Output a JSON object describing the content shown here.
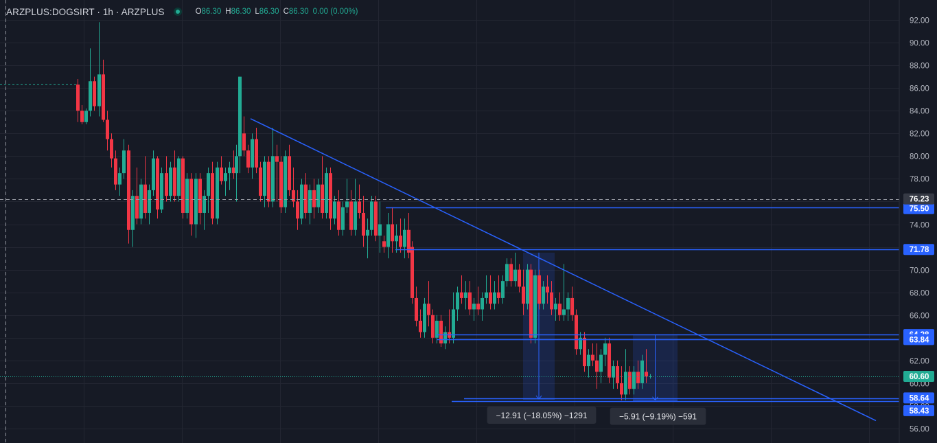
{
  "legend": {
    "symbol": "ARZPLUS:DOGSIRT · 1h · ARZPLUS",
    "o_key": "O",
    "o_val": "86.30",
    "h_key": "H",
    "h_val": "86.30",
    "l_key": "L",
    "l_val": "86.30",
    "c_key": "C",
    "c_val": "86.30",
    "change": "0.00 (0.00%)"
  },
  "colors": {
    "background": "#161a25",
    "up": "#22ab94",
    "down": "#f23645",
    "drawing": "#2962ff",
    "grid": "#232632"
  },
  "chart_data": {
    "type": "candlestick",
    "ylim": [
      55,
      93
    ],
    "y_ticks": [
      56,
      58,
      60,
      62,
      64,
      66,
      68,
      70,
      72,
      74,
      76,
      78,
      80,
      82,
      84,
      86,
      88,
      90,
      92
    ],
    "y_tick_labels": [
      "56.00",
      "58.00",
      "60.00",
      "62.00",
      "64.00",
      "66.00",
      "68.00",
      "70.00",
      "72.00",
      "74.00",
      "76.00",
      "78.00",
      "80.00",
      "82.00",
      "84.00",
      "86.00",
      "88.00",
      "90.00",
      "92.00"
    ],
    "x_range": [
      0,
      1310
    ],
    "candles": [
      [
        113,
        86.3,
        86.8,
        83.0,
        84.0
      ],
      [
        119,
        84.0,
        84.5,
        82.8,
        83.0
      ],
      [
        125,
        83.0,
        84.2,
        82.8,
        84.0
      ],
      [
        131,
        84.0,
        89.5,
        83.5,
        86.6
      ],
      [
        137,
        86.6,
        87.0,
        84.0,
        84.4
      ],
      [
        144,
        84.4,
        91.8,
        83.5,
        87.2
      ],
      [
        150,
        87.2,
        88.5,
        83.0,
        83.2
      ],
      [
        156,
        83.2,
        84.0,
        80.5,
        81.5
      ],
      [
        162,
        81.5,
        82.0,
        79.0,
        79.8
      ],
      [
        168,
        79.8,
        80.5,
        77.0,
        77.5
      ],
      [
        174,
        77.5,
        79.0,
        76.5,
        78.5
      ],
      [
        180,
        78.5,
        81.5,
        78.0,
        80.5
      ],
      [
        187,
        80.5,
        81.0,
        72.3,
        73.5
      ],
      [
        193,
        73.5,
        77.0,
        72.0,
        76.5
      ],
      [
        199,
        76.5,
        79.0,
        74.0,
        74.5
      ],
      [
        205,
        74.5,
        78.0,
        74.0,
        77.5
      ],
      [
        211,
        77.5,
        80.0,
        74.5,
        75.0
      ],
      [
        217,
        75.0,
        77.5,
        74.0,
        77.0
      ],
      [
        223,
        77.0,
        80.5,
        76.5,
        79.8
      ],
      [
        229,
        79.8,
        80.0,
        74.5,
        75.3
      ],
      [
        235,
        75.3,
        79.0,
        75.0,
        78.5
      ],
      [
        242,
        78.5,
        80.0,
        76.0,
        76.5
      ],
      [
        248,
        76.5,
        79.5,
        76.0,
        79.0
      ],
      [
        254,
        79.0,
        80.5,
        76.0,
        76.5
      ],
      [
        260,
        76.5,
        80.0,
        76.0,
        79.8
      ],
      [
        266,
        79.8,
        80.0,
        74.5,
        75.0
      ],
      [
        272,
        75.0,
        78.5,
        74.5,
        78.0
      ],
      [
        278,
        78.0,
        78.5,
        73.0,
        74.0
      ],
      [
        285,
        74.0,
        78.5,
        72.8,
        78.0
      ],
      [
        291,
        78.0,
        78.5,
        74.0,
        75.0
      ],
      [
        297,
        75.0,
        77.0,
        73.5,
        76.5
      ],
      [
        303,
        76.5,
        79.0,
        75.0,
        78.5
      ],
      [
        309,
        78.5,
        79.5,
        74.0,
        74.5
      ],
      [
        316,
        74.5,
        79.5,
        74.0,
        79.0
      ],
      [
        322,
        79.0,
        80.0,
        77.5,
        77.8
      ],
      [
        328,
        77.8,
        79.0,
        76.5,
        78.5
      ],
      [
        334,
        78.5,
        79.5,
        77.0,
        79.0
      ],
      [
        340,
        79.0,
        80.5,
        78.0,
        78.5
      ],
      [
        344,
        78.5,
        81.0,
        76.0,
        80.0
      ],
      [
        349,
        80.0,
        87.0,
        78.5,
        87.0
      ],
      [
        355,
        82.0,
        83.5,
        80.0,
        80.5
      ],
      [
        361,
        80.5,
        81.0,
        78.5,
        79.0
      ],
      [
        367,
        79.0,
        82.0,
        78.0,
        81.5
      ],
      [
        373,
        81.5,
        82.5,
        78.5,
        79.0
      ],
      [
        379,
        79.0,
        79.5,
        76.0,
        76.5
      ],
      [
        385,
        76.5,
        80.0,
        75.5,
        79.5
      ],
      [
        391,
        79.5,
        80.0,
        75.5,
        76.0
      ],
      [
        397,
        76.0,
        82.5,
        75.5,
        80.0
      ],
      [
        403,
        80.0,
        81.0,
        76.0,
        79.5
      ],
      [
        409,
        79.5,
        80.0,
        75.0,
        75.5
      ],
      [
        415,
        75.5,
        80.5,
        75.0,
        80.0
      ],
      [
        421,
        80.0,
        81.0,
        76.5,
        77.0
      ],
      [
        427,
        77.0,
        79.0,
        75.5,
        76.0
      ],
      [
        433,
        76.0,
        77.0,
        73.5,
        74.5
      ],
      [
        439,
        74.5,
        78.0,
        74.0,
        77.5
      ],
      [
        445,
        77.5,
        78.5,
        74.5,
        75.0
      ],
      [
        451,
        75.0,
        77.5,
        74.0,
        77.0
      ],
      [
        457,
        77.0,
        78.0,
        74.5,
        75.5
      ],
      [
        463,
        75.5,
        78.0,
        75.0,
        77.5
      ],
      [
        469,
        77.5,
        80.0,
        74.5,
        75.0
      ],
      [
        475,
        75.0,
        79.0,
        74.5,
        78.5
      ],
      [
        481,
        78.5,
        79.0,
        73.5,
        74.5
      ],
      [
        487,
        74.5,
        76.5,
        74.0,
        76.0
      ],
      [
        493,
        76.0,
        77.0,
        73.0,
        73.5
      ],
      [
        499,
        73.5,
        76.0,
        73.0,
        75.5
      ],
      [
        505,
        75.5,
        78.0,
        75.0,
        76.0
      ],
      [
        511,
        76.0,
        77.0,
        73.0,
        73.5
      ],
      [
        517,
        73.5,
        78.0,
        73.0,
        76.0
      ],
      [
        523,
        76.0,
        77.5,
        74.5,
        75.0
      ],
      [
        529,
        75.0,
        76.5,
        72.0,
        73.0
      ],
      [
        535,
        73.0,
        74.5,
        71.0,
        73.5
      ],
      [
        541,
        73.5,
        76.5,
        73.0,
        76.0
      ],
      [
        547,
        76.0,
        76.5,
        72.5,
        73.0
      ],
      [
        553,
        73.0,
        76.0,
        71.5,
        74.0
      ],
      [
        559,
        72.5,
        73.0,
        71.5,
        72.0
      ],
      [
        565,
        72.0,
        75.0,
        71.0,
        74.0
      ],
      [
        571,
        74.0,
        75.5,
        71.5,
        72.5
      ],
      [
        577,
        72.5,
        74.0,
        71.5,
        73.0
      ],
      [
        583,
        73.0,
        74.5,
        71.5,
        72.0
      ],
      [
        589,
        72.0,
        74.5,
        71.0,
        73.5
      ],
      [
        595,
        73.5,
        75.0,
        71.0,
        71.5
      ],
      [
        600,
        72.0,
        72.5,
        67.0,
        67.5
      ],
      [
        606,
        67.5,
        68.5,
        65.0,
        65.5
      ],
      [
        612,
        65.5,
        66.5,
        64.0,
        64.5
      ],
      [
        618,
        64.5,
        67.5,
        64.0,
        67.0
      ],
      [
        624,
        67.0,
        69.0,
        65.0,
        66.0
      ],
      [
        630,
        66.0,
        66.5,
        63.5,
        64.0
      ],
      [
        636,
        64.0,
        66.0,
        63.5,
        65.5
      ],
      [
        642,
        65.5,
        66.0,
        63.2,
        63.5
      ],
      [
        648,
        63.5,
        65.0,
        63.0,
        64.5
      ],
      [
        654,
        64.5,
        66.5,
        63.5,
        64.0
      ],
      [
        660,
        64.0,
        68.0,
        63.5,
        66.5
      ],
      [
        666,
        66.5,
        68.5,
        65.5,
        68.0
      ],
      [
        672,
        68.0,
        69.5,
        67.0,
        67.5
      ],
      [
        678,
        67.5,
        69.0,
        66.5,
        68.0
      ],
      [
        684,
        68.0,
        69.0,
        66.0,
        66.5
      ],
      [
        690,
        66.5,
        67.5,
        65.5,
        67.0
      ],
      [
        696,
        67.0,
        68.5,
        66.0,
        66.5
      ],
      [
        702,
        66.5,
        68.0,
        65.5,
        67.5
      ],
      [
        708,
        67.5,
        69.5,
        67.0,
        68.0
      ],
      [
        714,
        68.0,
        69.5,
        66.5,
        67.0
      ],
      [
        720,
        67.0,
        69.0,
        66.5,
        68.0
      ],
      [
        726,
        68.0,
        69.5,
        67.0,
        67.5
      ],
      [
        732,
        67.5,
        69.5,
        67.0,
        69.0
      ],
      [
        738,
        69.0,
        71.0,
        68.5,
        70.5
      ],
      [
        744,
        70.5,
        71.0,
        68.5,
        69.0
      ],
      [
        750,
        69.0,
        71.5,
        68.5,
        70.0
      ],
      [
        756,
        70.0,
        70.5,
        68.0,
        68.5
      ],
      [
        762,
        68.5,
        70.0,
        66.0,
        67.0
      ],
      [
        768,
        67.0,
        70.5,
        66.5,
        70.0
      ],
      [
        773,
        70.0,
        70.5,
        63.5,
        64.0
      ],
      [
        779,
        64.0,
        70.0,
        63.5,
        69.5
      ],
      [
        785,
        69.5,
        70.0,
        66.5,
        67.0
      ],
      [
        791,
        67.0,
        69.0,
        66.5,
        68.5
      ],
      [
        797,
        68.5,
        69.5,
        67.0,
        68.0
      ],
      [
        803,
        68.0,
        69.0,
        66.0,
        66.5
      ],
      [
        809,
        66.5,
        67.5,
        65.5,
        67.0
      ],
      [
        815,
        67.0,
        68.0,
        65.5,
        66.0
      ],
      [
        821,
        66.0,
        70.5,
        65.5,
        66.5
      ],
      [
        827,
        66.5,
        68.0,
        65.5,
        67.5
      ],
      [
        833,
        67.5,
        68.5,
        65.5,
        66.0
      ],
      [
        839,
        66.0,
        66.5,
        62.5,
        63.0
      ],
      [
        845,
        63.0,
        64.5,
        62.5,
        64.0
      ],
      [
        851,
        64.0,
        64.5,
        61.0,
        61.5
      ],
      [
        857,
        61.5,
        63.0,
        60.5,
        62.5
      ],
      [
        863,
        62.5,
        63.5,
        61.5,
        62.0
      ],
      [
        869,
        62.0,
        63.5,
        59.5,
        61.0
      ],
      [
        875,
        61.0,
        63.0,
        60.0,
        62.5
      ],
      [
        881,
        62.5,
        64.0,
        61.5,
        63.5
      ],
      [
        887,
        63.5,
        64.0,
        60.0,
        60.5
      ],
      [
        893,
        60.5,
        62.0,
        59.5,
        61.5
      ],
      [
        899,
        61.5,
        62.0,
        59.5,
        60.0
      ],
      [
        905,
        60.0,
        61.5,
        58.5,
        59.0
      ],
      [
        911,
        59.0,
        63.0,
        58.5,
        61.0
      ],
      [
        917,
        61.0,
        61.5,
        59.0,
        59.5
      ],
      [
        923,
        59.5,
        61.5,
        59.0,
        61.0
      ],
      [
        929,
        61.0,
        62.0,
        59.5,
        60.0
      ],
      [
        935,
        60.0,
        62.5,
        59.5,
        62.0
      ],
      [
        941,
        61.0,
        63.0,
        60.0,
        60.6
      ],
      [
        947,
        60.6,
        60.8,
        60.4,
        60.6
      ]
    ]
  },
  "drawings": {
    "price_lines": [
      {
        "price": 75.5,
        "x_start": 562,
        "label": "75.50"
      },
      {
        "price": 71.78,
        "x_start": 576,
        "label": "71.78"
      },
      {
        "price": 64.28,
        "x_start": 636,
        "label": "64.28"
      },
      {
        "price": 63.84,
        "x_start": 636,
        "label": "63.84"
      },
      {
        "price": 58.64,
        "x_start": 676,
        "label": "58.64"
      },
      {
        "price": 58.43,
        "x_start": 658,
        "label": "58.43"
      }
    ],
    "trendline": {
      "x1": 365,
      "p1": 83.3,
      "x2": 1276,
      "p2": 56.7
    },
    "measures": [
      {
        "x1": 762,
        "x2": 808,
        "p_top": 71.5,
        "p_bot": 58.6,
        "label": "−12.91 (−18.05%) −1291"
      },
      {
        "x1": 922,
        "x2": 987,
        "p_top": 64.28,
        "p_bot": 58.5,
        "label": "−5.91 (−9.19%) −591"
      }
    ],
    "last_price": {
      "price": 60.6,
      "label": "60.60"
    },
    "crosshair": {
      "price": 76.23,
      "label": "76.23"
    },
    "prev_dashed_price": 86.3
  }
}
